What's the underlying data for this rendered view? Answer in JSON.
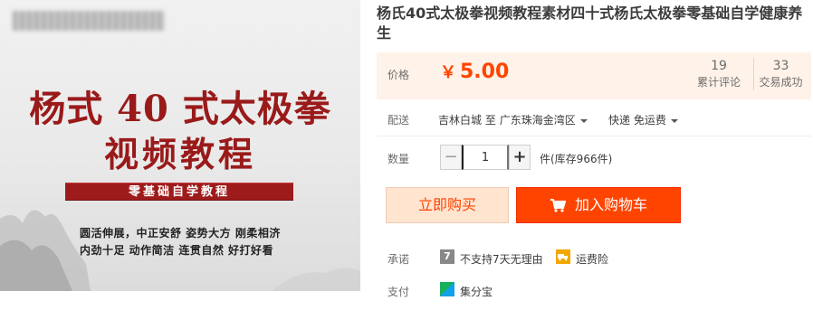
{
  "image": {
    "title_line1": "杨式 40 式太极拳",
    "title_line2": "视频教程",
    "banner": "零基础自学教程",
    "tagline_line1": "圆活伸展，中正安舒    姿势大方    刚柔相济",
    "tagline_line2": "内劲十足    动作简洁    连贯自然    好打好看"
  },
  "product": {
    "title": "杨氏40式太极拳视频教程素材四十式杨氏太极拳零基础自学健康养生"
  },
  "price": {
    "label": "价格",
    "currency": "￥",
    "amount": "5.00",
    "reviews_count": "19",
    "reviews_label": "累计评论",
    "deals_count": "33",
    "deals_label": "交易成功"
  },
  "shipping": {
    "label": "配送",
    "from": "吉林白城",
    "to_word": "至",
    "destination": "广东珠海金湾区",
    "method": "快递 免运费"
  },
  "quantity": {
    "label": "数量",
    "value": "1",
    "unit_stock": "件(库存966件)",
    "minus": "−",
    "plus": "+"
  },
  "actions": {
    "buy_now": "立即购买",
    "add_cart": "加入购物车"
  },
  "promise": {
    "label": "承诺",
    "badge1": "7",
    "item1": "不支持7天无理由",
    "item2": "运费险"
  },
  "payment": {
    "label": "支付",
    "item1": "集分宝"
  },
  "colors": {
    "accent": "#ff4400",
    "price_bg": "#fff2e8",
    "buy_bg": "#ffe4d0"
  }
}
